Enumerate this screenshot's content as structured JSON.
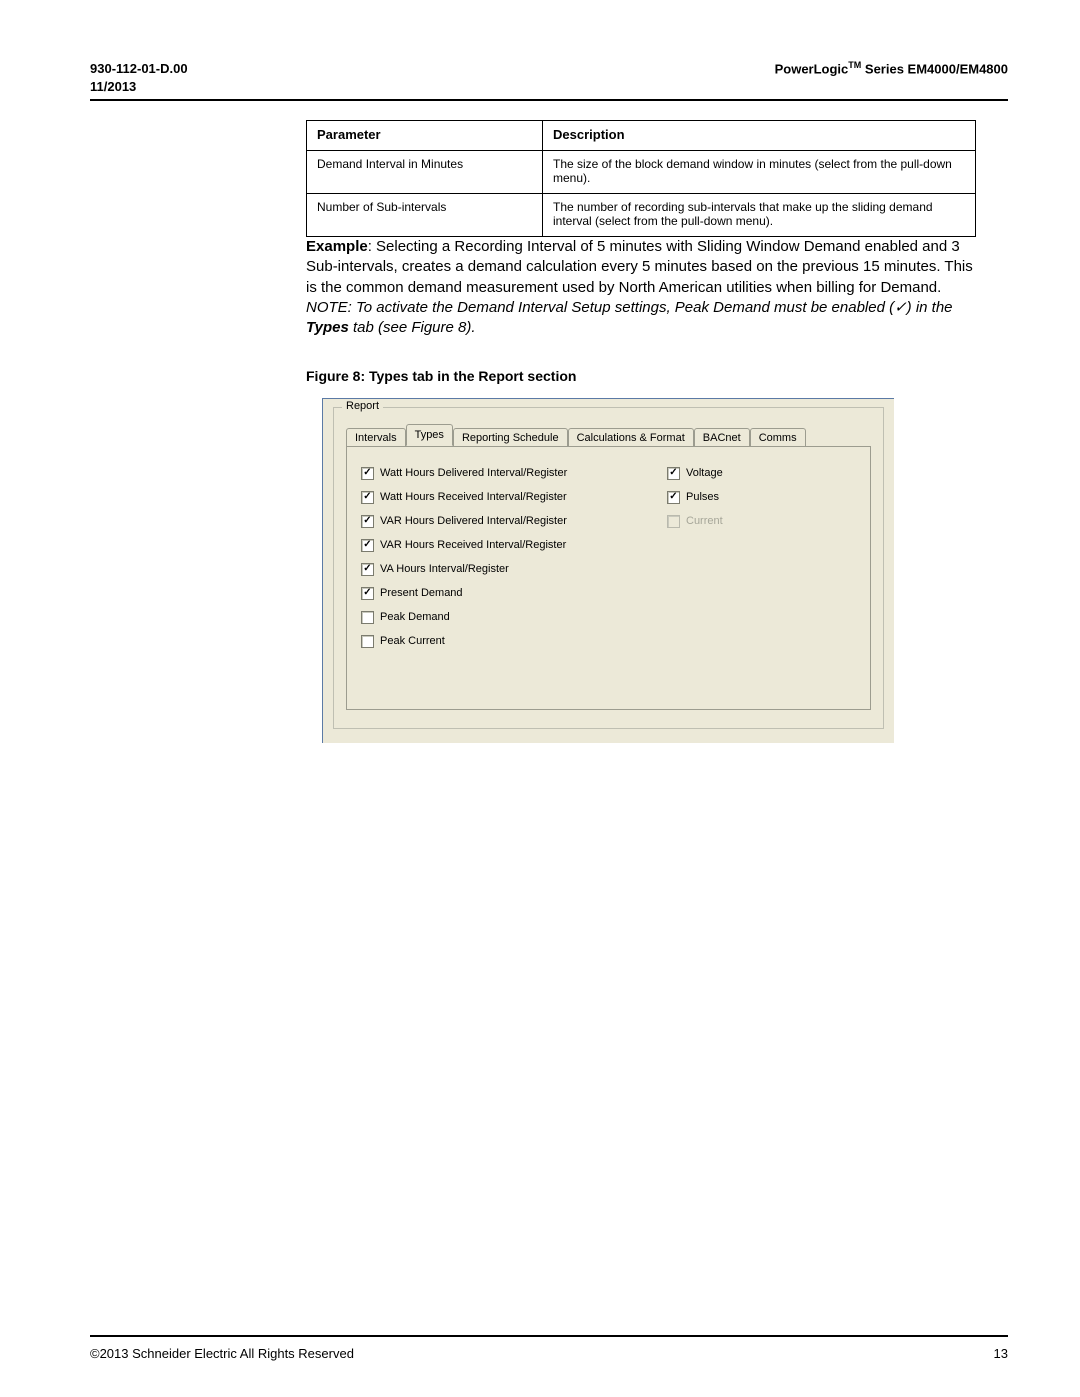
{
  "header": {
    "doc_number": "930-112-01-D.00",
    "doc_date": "11/2013",
    "brand": "PowerLogic",
    "tm": "TM",
    "series": " Series EM4000/EM4800"
  },
  "param_table": {
    "headers": {
      "param": "Parameter",
      "desc": "Description"
    },
    "rows": [
      {
        "param": "Demand Interval in Minutes",
        "desc": "The size of the block demand window in minutes (select from the pull-down menu)."
      },
      {
        "param": "Number of Sub-intervals",
        "desc": "The number of recording sub-intervals that make up the sliding demand interval (select from the pull-down menu)."
      }
    ]
  },
  "example": {
    "label": "Example",
    "text": ": Selecting a Recording Interval of 5 minutes with Sliding Window Demand enabled and 3 Sub-intervals, creates a demand calculation every 5 minutes based on the previous 15 minutes. This is the common demand measurement used by North American utilities when billing for Demand."
  },
  "note": {
    "prefix": "NOTE: To activate the Demand Interval Setup settings, Peak Demand must be enabled (",
    "check": "✓",
    "mid": ") in the ",
    "types_word": "Types",
    "suffix": " tab (see Figure 8)."
  },
  "figure_caption": "Figure 8:  Types tab in the Report section",
  "report_panel": {
    "group_title": "Report",
    "tabs": [
      {
        "label": "Intervals",
        "active": false
      },
      {
        "label": "Types",
        "active": true
      },
      {
        "label": "Reporting Schedule",
        "active": false
      },
      {
        "label": "Calculations & Format",
        "active": false
      },
      {
        "label": "BACnet",
        "active": false
      },
      {
        "label": "Comms",
        "active": false
      }
    ],
    "left_checks": [
      {
        "label": "Watt Hours Delivered Interval/Register",
        "checked": true,
        "disabled": false
      },
      {
        "label": "Watt Hours Received Interval/Register",
        "checked": true,
        "disabled": false
      },
      {
        "label": "VAR Hours Delivered Interval/Register",
        "checked": true,
        "disabled": false
      },
      {
        "label": "VAR Hours Received Interval/Register",
        "checked": true,
        "disabled": false
      },
      {
        "label": "VA Hours Interval/Register",
        "checked": true,
        "disabled": false
      },
      {
        "label": "Present Demand",
        "checked": true,
        "disabled": false
      },
      {
        "label": "Peak Demand",
        "checked": false,
        "disabled": false
      },
      {
        "label": "Peak Current",
        "checked": false,
        "disabled": false
      }
    ],
    "right_checks": [
      {
        "label": "Voltage",
        "checked": true,
        "disabled": false
      },
      {
        "label": "Pulses",
        "checked": true,
        "disabled": false
      },
      {
        "label": "Current",
        "checked": false,
        "disabled": true
      }
    ]
  },
  "footer": {
    "copyright": "©2013 Schneider Electric All Rights Reserved",
    "page_number": "13"
  }
}
